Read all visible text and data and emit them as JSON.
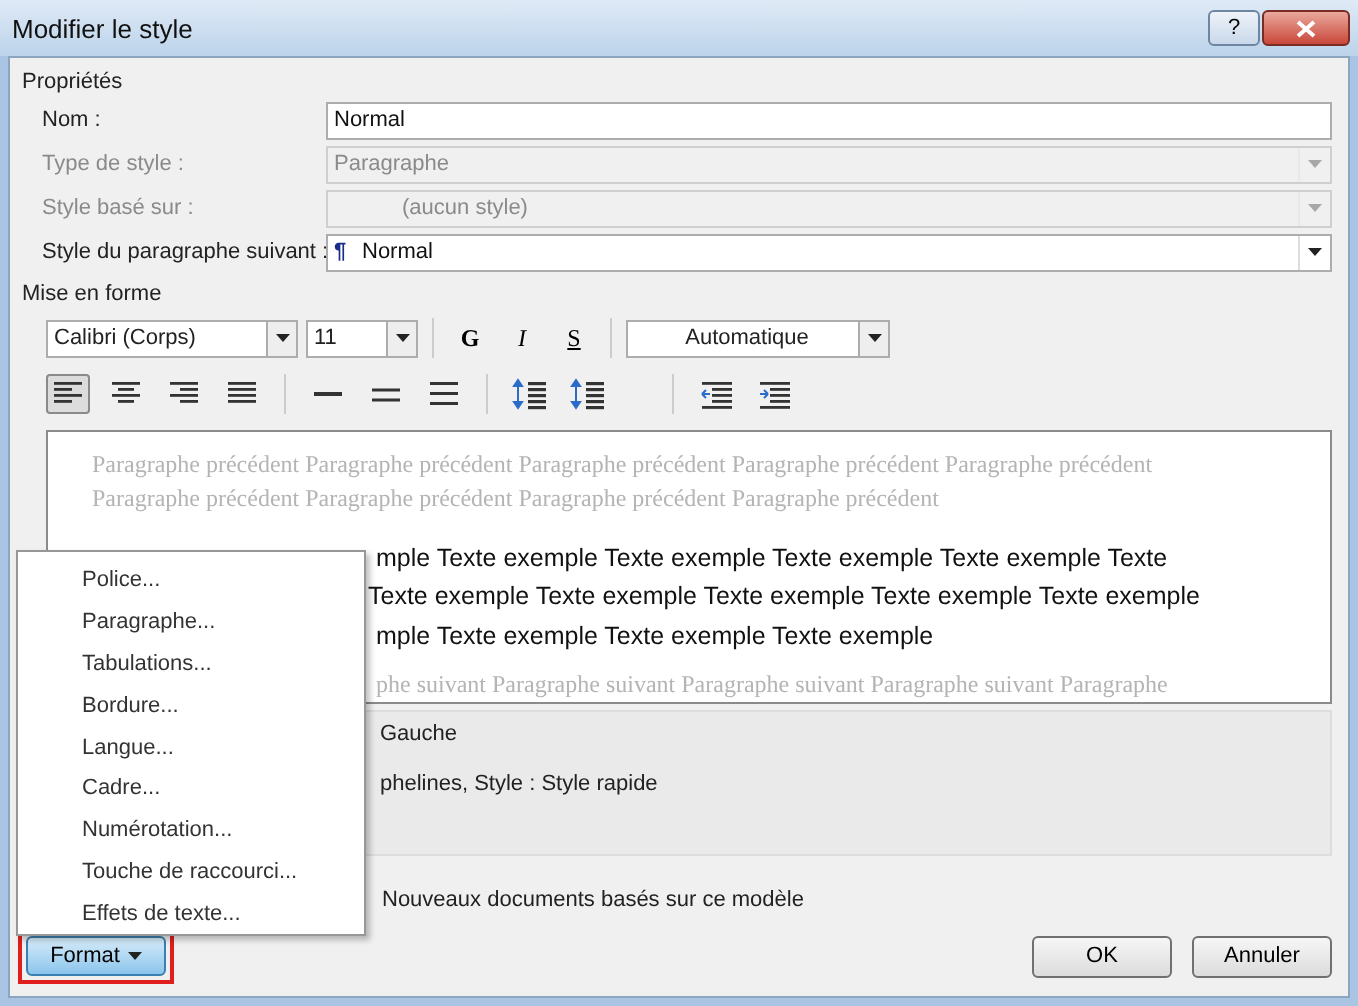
{
  "window": {
    "title": "Modifier le style",
    "help": "?"
  },
  "properties": {
    "title": "Propriétés",
    "fields": [
      {
        "label": "Nom :",
        "value": "Normal",
        "kind": "text",
        "disabled": false
      },
      {
        "label": "Type de style :",
        "value": "Paragraphe",
        "kind": "select",
        "disabled": true
      },
      {
        "label": "Style basé sur :",
        "value": "(aucun style)",
        "kind": "style-select",
        "disabled": true
      },
      {
        "label": "Style du paragraphe suivant :",
        "value": "Normal",
        "kind": "style-select",
        "symbol": "¶",
        "disabled": false
      }
    ]
  },
  "formatting": {
    "title": "Mise en forme",
    "font": "Calibri (Corps)",
    "size": "11",
    "styles": [
      {
        "label": "G",
        "kind": "bold"
      },
      {
        "label": "I",
        "kind": "italic"
      },
      {
        "label": "S",
        "kind": "underline"
      }
    ],
    "font_color": "Automatique",
    "paragraph_tools": [
      {
        "kind": "align-left",
        "selected": true
      },
      {
        "kind": "align-center",
        "selected": false
      },
      {
        "kind": "align-right",
        "selected": false
      },
      {
        "kind": "justify",
        "selected": false
      },
      {
        "kind": "single-spacing",
        "selected": false
      },
      {
        "kind": "one-half-spacing",
        "selected": false
      },
      {
        "kind": "double-spacing",
        "selected": false
      },
      {
        "kind": "space-before",
        "selected": false
      },
      {
        "kind": "space-after",
        "selected": false
      },
      {
        "kind": "indent-decrease",
        "selected": false
      },
      {
        "kind": "indent-increase",
        "selected": false
      }
    ]
  },
  "preview": {
    "preceding": [
      "Paragraphe précédent Paragraphe précédent Paragraphe précédent Paragraphe précédent Paragraphe précédent",
      "Paragraphe précédent Paragraphe précédent Paragraphe précédent Paragraphe précédent"
    ],
    "sample": [
      "mple Texte exemple Texte exemple Texte exemple Texte exemple Texte",
      "Texte exemple Texte exemple Texte exemple Texte exemple Texte exemple",
      "mple Texte exemple Texte exemple Texte exemple"
    ],
    "following": "phe suivant Paragraphe suivant Paragraphe suivant Paragraphe suivant Paragraphe"
  },
  "description": [
    "Gauche",
    "phelines, Style : Style rapide"
  ],
  "template_option": "Nouveaux documents basés sur ce modèle",
  "format_menu": [
    "Police...",
    "Paragraphe...",
    "Tabulations...",
    "Bordure...",
    "Langue...",
    "Cadre...",
    "Numérotation...",
    "Touche de raccourci...",
    "Effets de texte..."
  ],
  "format_button": {
    "label": "Format",
    "highlighted": true
  },
  "buttons": [
    "OK",
    "Annuler"
  ]
}
